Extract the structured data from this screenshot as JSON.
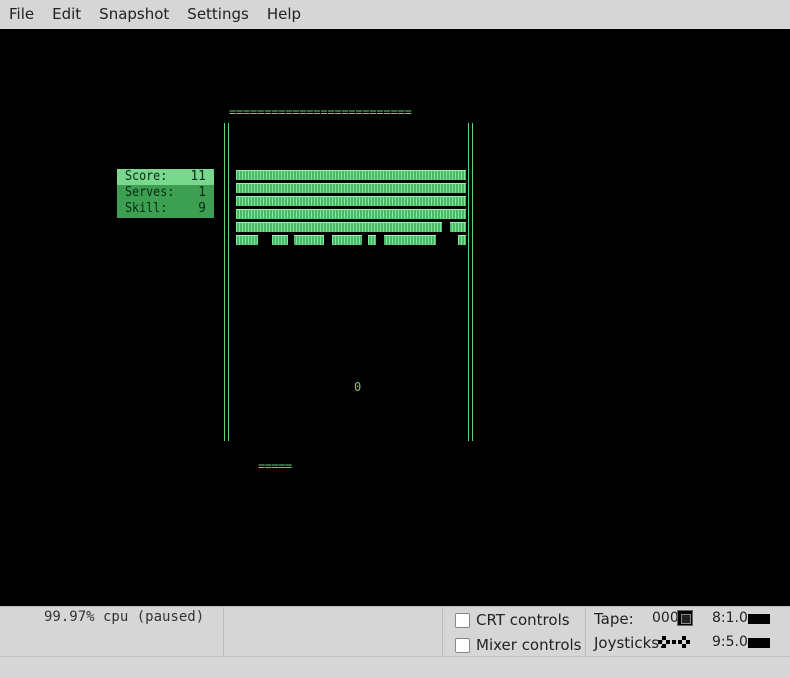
{
  "menu": [
    "File",
    "Edit",
    "Snapshot",
    "Settings",
    "Help"
  ],
  "game": {
    "top_wall": "==========================",
    "hud": [
      {
        "label": "Score:",
        "value": "11"
      },
      {
        "label": "Serves:",
        "value": "1"
      },
      {
        "label": "Skill:",
        "value": "9"
      }
    ],
    "ball": "0",
    "paddle": "====="
  },
  "status": {
    "cpu": "99.97% cpu (paused)",
    "crt_controls": "CRT controls",
    "mixer_controls": "Mixer controls",
    "tape_label": "Tape:",
    "tape_value": "000",
    "speed_1": "8:1.0",
    "speed_2": "9:5.0",
    "joysticks_label": "Joysticks:"
  },
  "colors": {
    "phosphor_green": "#5fd37a",
    "hud_bg": "#3d9f52",
    "chrome": "#d6d6d6"
  }
}
